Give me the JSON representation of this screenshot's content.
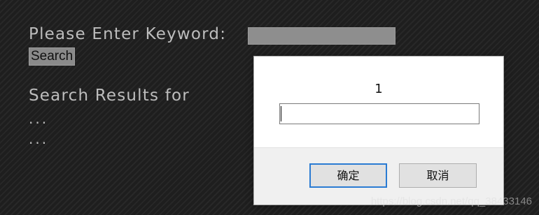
{
  "search_form": {
    "label": "Please Enter Keyword:",
    "input_value": "",
    "button_label": "Search"
  },
  "results": {
    "title": "Search Results for",
    "line1": "...",
    "line2": "..."
  },
  "prompt_dialog": {
    "message": "1",
    "input_value": "",
    "ok_label": "确定",
    "cancel_label": "取消"
  },
  "watermark": "https://blog.csdn.net/qq_38433146"
}
